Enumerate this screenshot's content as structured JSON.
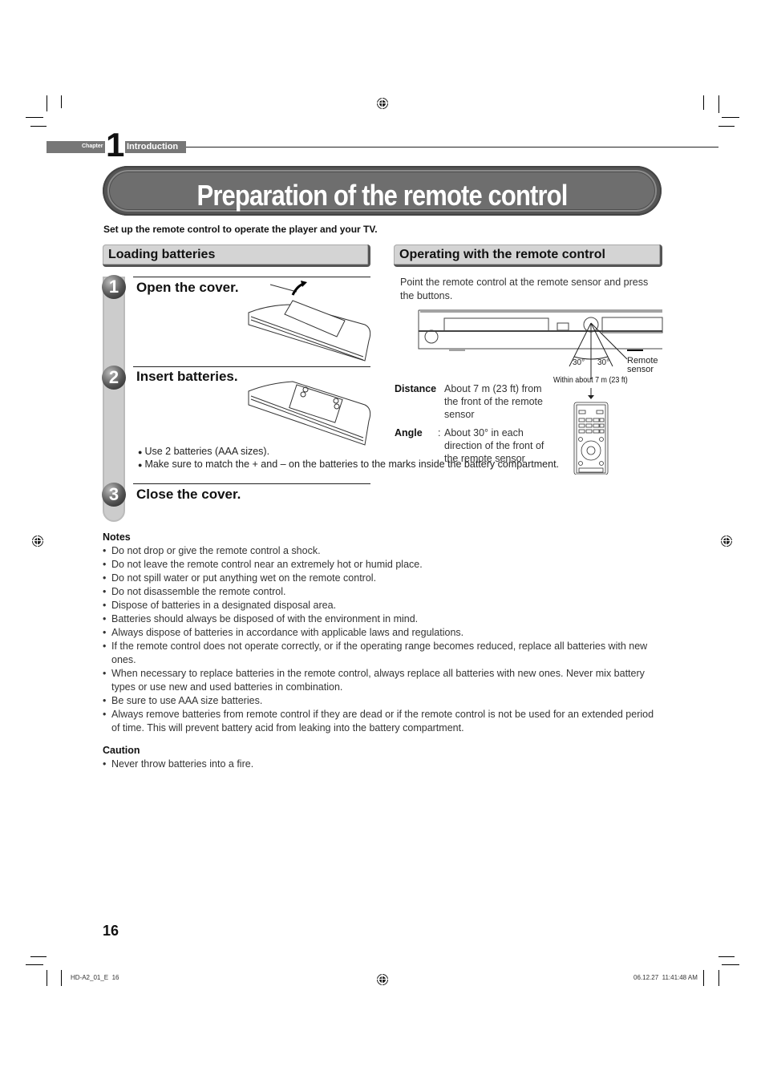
{
  "chapter": {
    "label": "Chapter",
    "number": "1",
    "title": "Introduction"
  },
  "page_title": "Preparation of the remote control",
  "intro": "Set up the remote control to operate the player and your TV.",
  "loading": {
    "heading": "Loading batteries",
    "steps": [
      {
        "number": "1",
        "title": "Open the cover."
      },
      {
        "number": "2",
        "title": "Insert batteries."
      },
      {
        "number": "3",
        "title": "Close the cover."
      }
    ],
    "bullets": [
      "Use 2 batteries (AAA sizes).",
      "Make sure to match the + and – on the batteries to the marks inside the battery compartment."
    ],
    "bullet_glyph": "●"
  },
  "operating": {
    "heading": "Operating with the remote control",
    "description": "Point the remote control at the remote sensor and press the buttons.",
    "diagram": {
      "angle_left": "30°",
      "angle_right": "30°",
      "sensor_label_1": "Remote",
      "sensor_label_2": "sensor",
      "range_label": "Within about 7 m (23 ft)"
    },
    "specs": [
      {
        "label": "Distance",
        "sep": ":",
        "value": "About 7 m (23 ft) from the front of the remote sensor"
      },
      {
        "label": "Angle",
        "sep": ":",
        "value": "About 30° in each direction of the front of the remote sensor"
      }
    ]
  },
  "notes": {
    "title": "Notes",
    "bullet": "•",
    "items": [
      "Do not drop or give the remote control a shock.",
      "Do not leave the remote control near an extremely hot or humid place.",
      "Do not spill water or put anything wet on the remote control.",
      "Do not disassemble the remote control.",
      "Dispose of batteries in a designated disposal area.",
      "Batteries should always be disposed of with the environment in mind.",
      "Always dispose of batteries in accordance with applicable laws and regulations.",
      "If the remote control does not operate correctly, or if the operating range becomes reduced, replace all batteries with new ones.",
      "When necessary to replace batteries in the remote control, always replace all batteries with new ones. Never mix battery types or use new and used batteries in combination.",
      "Be sure to use AAA size batteries.",
      "Always remove batteries from remote control if they are dead or if the remote control is not be used for an extended period of time. This will prevent battery acid from leaking into the battery compartment."
    ]
  },
  "caution": {
    "title": "Caution",
    "items": [
      "Never throw batteries into a fire."
    ]
  },
  "page_number": "16",
  "footer": {
    "left": "HD-A2_01_E  16",
    "right": "06.12.27  11:41:48 AM"
  }
}
